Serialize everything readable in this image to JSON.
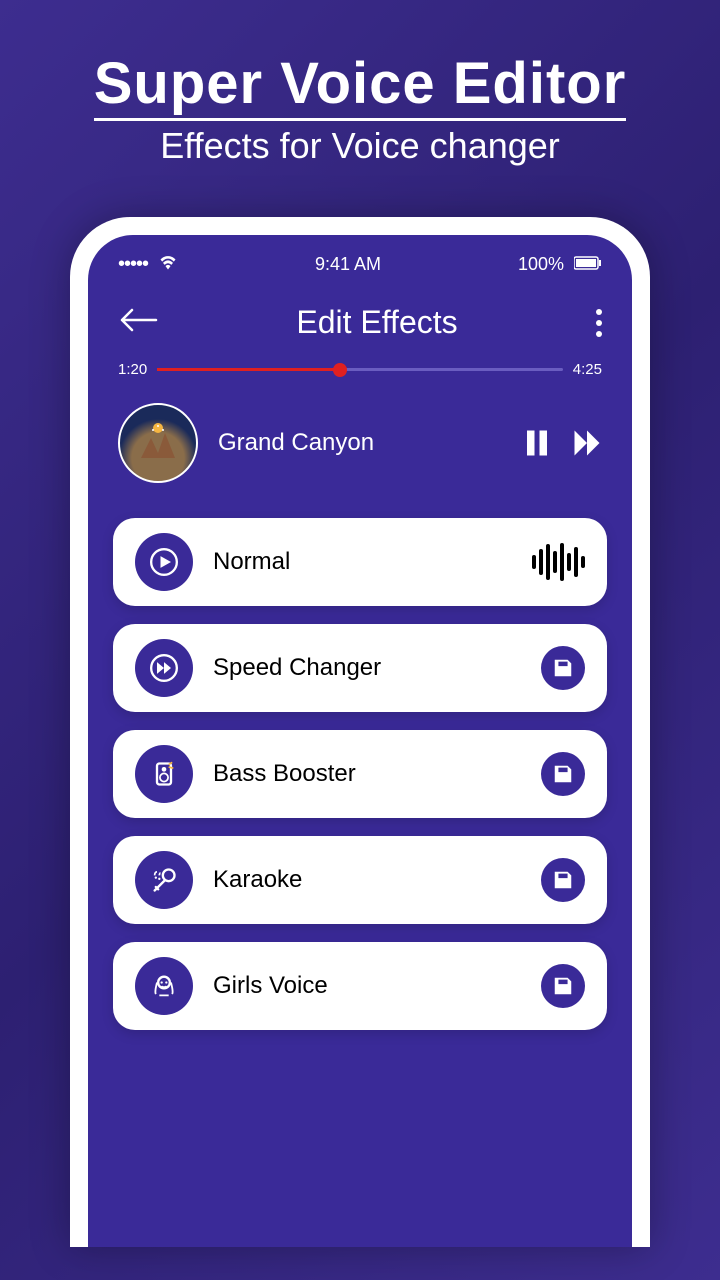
{
  "promo": {
    "title": "Super Voice Editor",
    "subtitle": "Effects for Voice changer"
  },
  "status": {
    "time": "9:41 AM",
    "battery": "100%"
  },
  "header": {
    "title": "Edit Effects"
  },
  "player": {
    "elapsed": "1:20",
    "total": "4:25",
    "trackName": "Grand Canyon"
  },
  "effects": [
    {
      "label": "Normal",
      "icon": "play",
      "action": "wave"
    },
    {
      "label": "Speed Changer",
      "icon": "ff",
      "action": "save"
    },
    {
      "label": "Bass Booster",
      "icon": "speaker",
      "action": "save"
    },
    {
      "label": "Karaoke",
      "icon": "mic",
      "action": "save"
    },
    {
      "label": "Girls Voice",
      "icon": "girl",
      "action": "save"
    }
  ]
}
